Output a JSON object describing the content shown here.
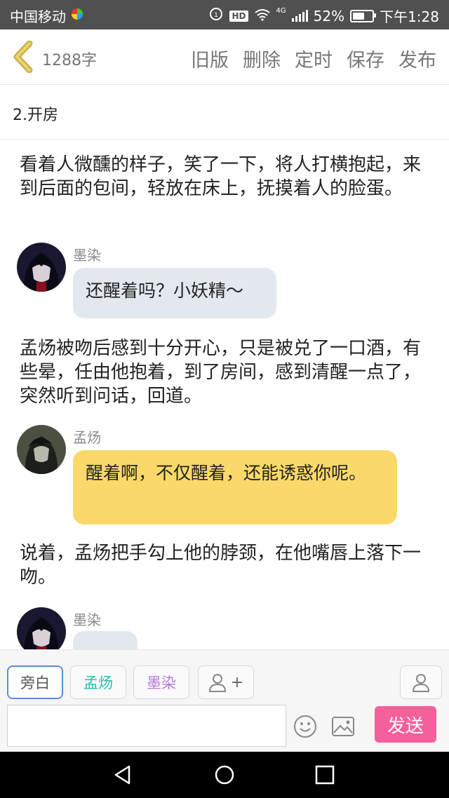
{
  "status_bar": {
    "carrier": "中国移动",
    "network": "4G",
    "battery": "52%",
    "time": "下午1:28",
    "hd_label": "HD"
  },
  "toolbar": {
    "word_count": "1288字",
    "actions": [
      "旧版",
      "删除",
      "定时",
      "保存",
      "发布"
    ]
  },
  "chapter_title": "2.开房",
  "story": {
    "narration_1": "看着人微醺的样子，笑了一下，将人打横抱起，来到后面的包间，轻放在床上，抚摸着人的脸蛋。",
    "message_1": {
      "speaker": "墨染",
      "text": "还醒着吗？小妖精～"
    },
    "narration_2": "孟炀被吻后感到十分开心，只是被兑了一口酒，有些晕，任由他抱着，到了房间，感到清醒一点了，突然听到问话，回道。",
    "message_2": {
      "speaker": "孟炀",
      "text": "醒着啊，不仅醒着，还能诱惑你呢。"
    },
    "narration_3": "说着，孟炀把手勾上他的脖颈，在他嘴唇上落下一吻。",
    "message_3": {
      "speaker": "墨染",
      "text": ""
    }
  },
  "character_bar": {
    "chips": [
      {
        "label": "旁白",
        "color": "#555555"
      },
      {
        "label": "孟炀",
        "color": "#2fb8a6"
      },
      {
        "label": "墨染",
        "color": "#b57ad6"
      }
    ],
    "add_label": "+",
    "send_label": "发送",
    "input_placeholder": ""
  },
  "colors": {
    "send": "#f5609a",
    "bubble_blue": "#e3e8ee",
    "bubble_yellow": "#fad96a",
    "selected_border": "#5a8ed8"
  }
}
